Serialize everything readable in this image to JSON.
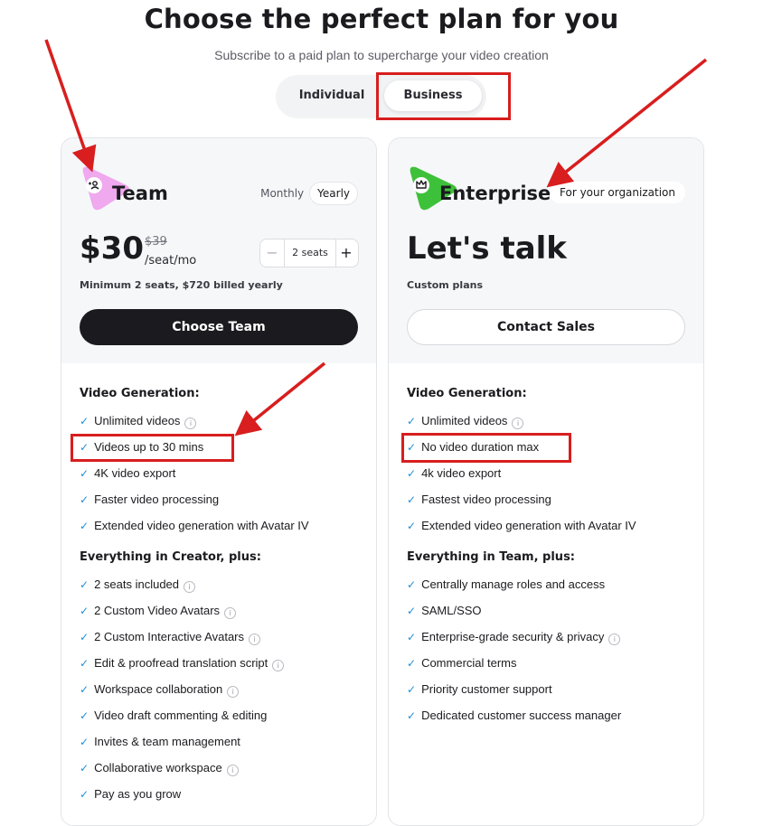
{
  "header": {
    "title": "Choose the perfect plan for you",
    "subtitle": "Subscribe to a paid plan to supercharge your video creation"
  },
  "toggle": {
    "options": [
      "Individual",
      "Business"
    ],
    "selected": "Business"
  },
  "team": {
    "name": "Team",
    "billing_monthly": "Monthly",
    "billing_yearly": "Yearly",
    "price": "$30",
    "old_price": "$39",
    "per_seat": "/seat/mo",
    "stepper": {
      "minus": "−",
      "value": "2 seats",
      "plus": "+"
    },
    "note": "Minimum 2 seats, $720 billed yearly",
    "cta": "Choose Team",
    "sections": [
      {
        "title": "Video Generation:",
        "features": [
          {
            "label": "Unlimited videos",
            "info": true
          },
          {
            "label": "Videos up to 30 mins",
            "info": false
          },
          {
            "label": "4K video export",
            "info": false
          },
          {
            "label": "Faster video processing",
            "info": false
          },
          {
            "label": "Extended video generation with Avatar IV",
            "info": false
          }
        ]
      },
      {
        "title": "Everything in Creator, plus:",
        "features": [
          {
            "label": "2 seats included",
            "info": true
          },
          {
            "label": "2 Custom Video Avatars",
            "info": true
          },
          {
            "label": "2 Custom Interactive Avatars",
            "info": true
          },
          {
            "label": "Edit & proofread translation script",
            "info": true
          },
          {
            "label": "Workspace collaboration",
            "info": true
          },
          {
            "label": "Video draft commenting & editing",
            "info": false
          },
          {
            "label": "Invites & team management",
            "info": false
          },
          {
            "label": "Collaborative workspace",
            "info": true
          },
          {
            "label": "Pay as you grow",
            "info": false
          }
        ]
      }
    ]
  },
  "enterprise": {
    "name": "Enterprise",
    "badge": "For your organization",
    "headline": "Let's talk",
    "note": "Custom plans",
    "cta": "Contact Sales",
    "sections": [
      {
        "title": "Video Generation:",
        "features": [
          {
            "label": "Unlimited videos",
            "info": true
          },
          {
            "label": "No video duration max",
            "info": false
          },
          {
            "label": "4k video export",
            "info": false
          },
          {
            "label": "Fastest video processing",
            "info": false
          },
          {
            "label": "Extended video generation with Avatar IV",
            "info": false
          }
        ]
      },
      {
        "title": "Everything in Team, plus:",
        "features": [
          {
            "label": "Centrally manage roles and access",
            "info": false
          },
          {
            "label": "SAML/SSO",
            "info": false
          },
          {
            "label": "Enterprise-grade security & privacy",
            "info": true
          },
          {
            "label": "Commercial terms",
            "info": false
          },
          {
            "label": "Priority customer support",
            "info": false
          },
          {
            "label": "Dedicated customer success manager",
            "info": false
          }
        ]
      }
    ]
  },
  "icons": {
    "check": "check-icon",
    "info": "info-icon",
    "team_logo": "team-add-user-icon",
    "enterprise_logo": "crown-icon"
  },
  "colors": {
    "team_logo": "#f0a8ef",
    "enterprise_logo": "#3ec13a",
    "check": "#1e8fd8",
    "annotation": "#d81e1e",
    "cta_dark": "#1b1b1f"
  }
}
